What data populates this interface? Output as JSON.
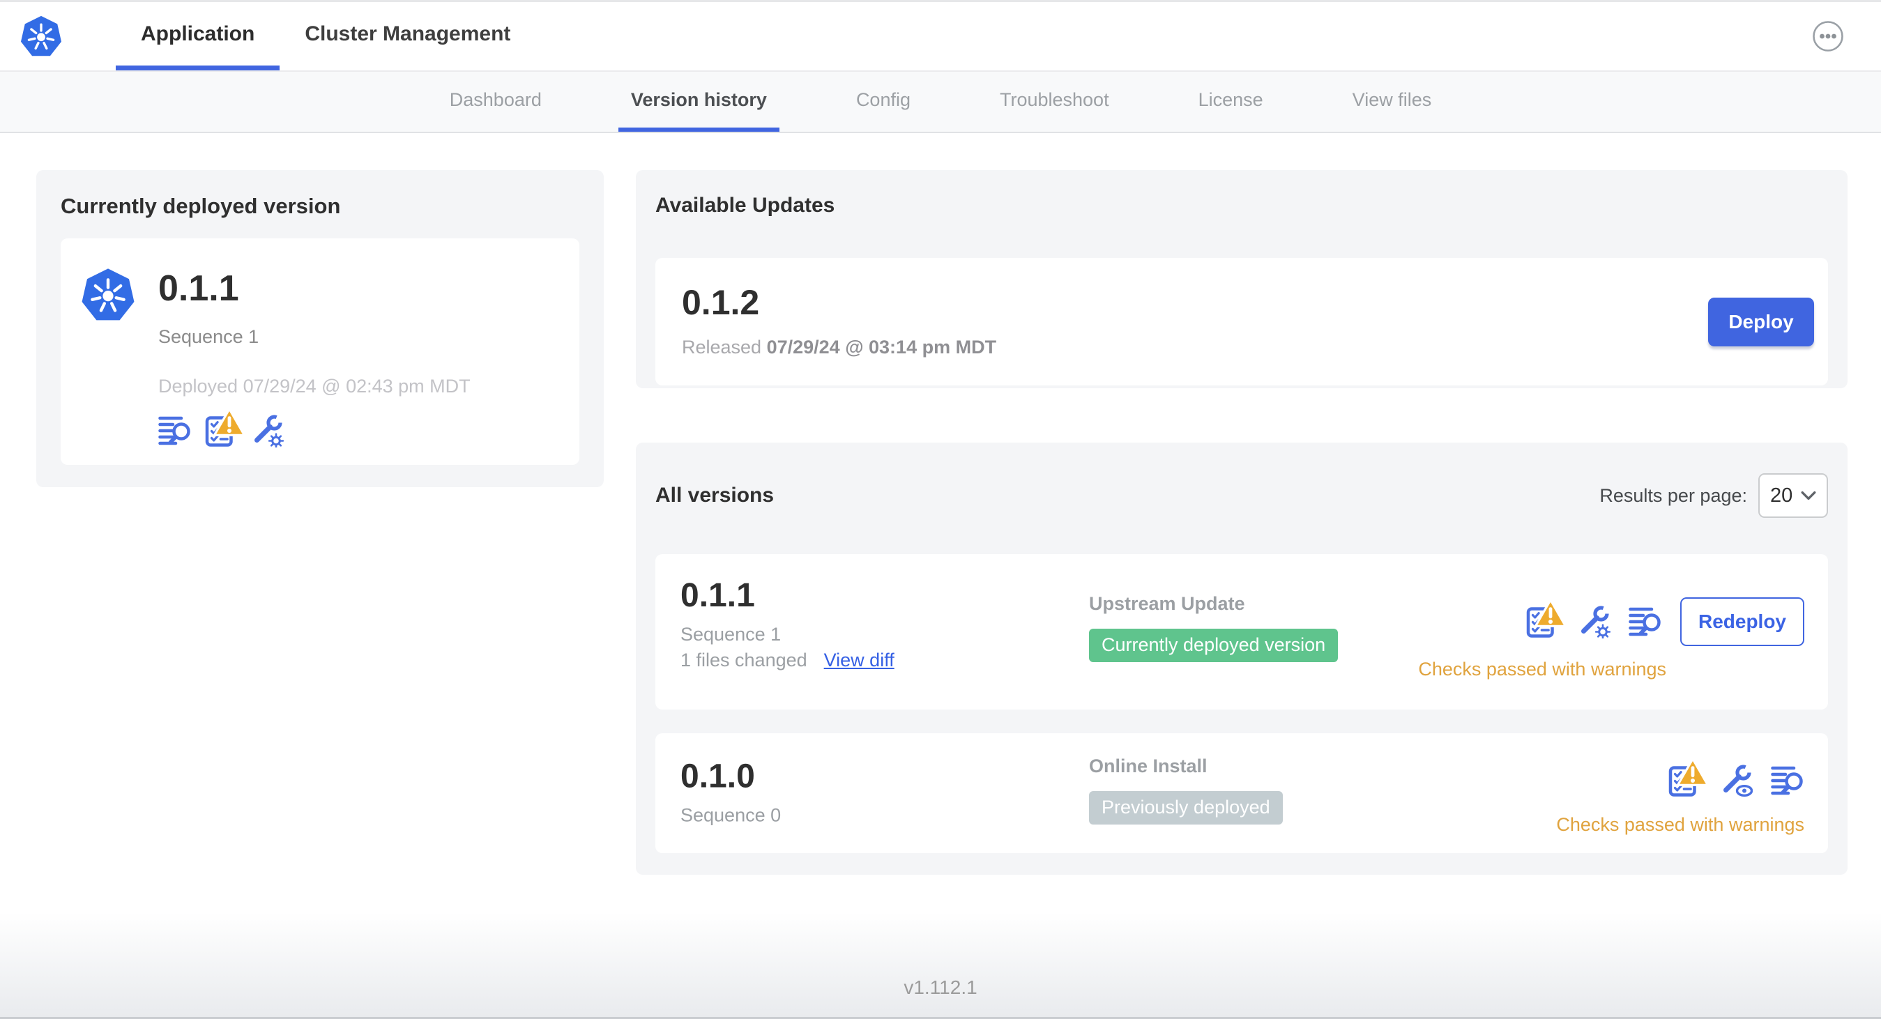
{
  "top_nav": {
    "tabs": [
      {
        "label": "Application",
        "active": true
      },
      {
        "label": "Cluster Management",
        "active": false
      }
    ],
    "menu_icon": "ellipsis-menu-icon"
  },
  "sub_nav": {
    "tabs": [
      "Dashboard",
      "Version history",
      "Config",
      "Troubleshoot",
      "License",
      "View files"
    ],
    "active_tab": "Version history"
  },
  "currently_deployed": {
    "title": "Currently deployed version",
    "logo_icon": "kubernetes-logo",
    "version": "0.1.1",
    "sequence": "Sequence 1",
    "deployed_at": "Deployed 07/29/24 @ 02:43 pm MDT",
    "icons": [
      "diff-icon",
      "preflight-checks-warning-icon",
      "edit-config-icon"
    ]
  },
  "available_updates": {
    "title": "Available Updates",
    "version": "0.1.2",
    "released_label": "Released",
    "released_at": "07/29/24 @ 03:14 pm MDT",
    "deploy_button": "Deploy"
  },
  "all_versions": {
    "title": "All versions",
    "results_per_page_label": "Results per page:",
    "results_per_page": "20",
    "rows": [
      {
        "version": "0.1.1",
        "sequence": "Sequence 1",
        "files_changed": "1 files changed",
        "view_diff_link": "View diff",
        "source": "Upstream Update",
        "status_badge": "Currently deployed version",
        "icons": [
          "preflight-checks-warning-icon",
          "edit-config-icon",
          "diff-icon"
        ],
        "action_button": "Redeploy",
        "checks_status": "Checks passed with warnings"
      },
      {
        "version": "0.1.0",
        "sequence": "Sequence 0",
        "source": "Online Install",
        "status_badge": "Previously deployed",
        "icons": [
          "preflight-checks-warning-icon",
          "view-config-icon",
          "diff-icon"
        ],
        "checks_status": "Checks passed with warnings"
      }
    ]
  },
  "footer": {
    "console_version": "v1.112.1"
  },
  "colors": {
    "accent_blue": "#4065e0",
    "icon_blue": "#4a70e2",
    "link_blue": "#3560e4",
    "badge_green": "#5fc48d",
    "badge_gray": "#c3cdd1",
    "warning_text_orange": "#e0a33e",
    "warning_triangle_orange": "#eeab2d",
    "kubernetes_blue": "#326ce5"
  }
}
